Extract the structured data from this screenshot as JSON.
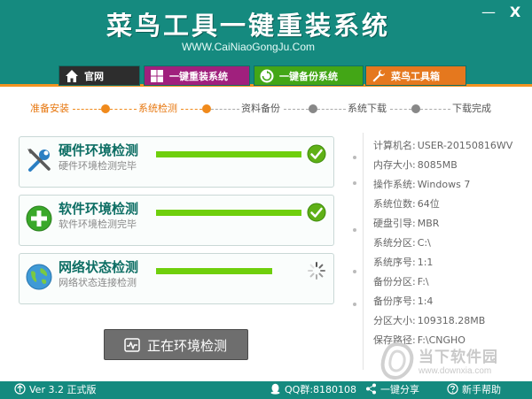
{
  "window": {
    "title": "菜鸟工具一键重装系统",
    "url": "WWW.CaiNiaoGongJu.Com",
    "minimize": "—",
    "close": "X"
  },
  "nav": {
    "tabs": [
      {
        "label": "官网",
        "icon": "home-icon",
        "color": "#2d2d2d"
      },
      {
        "label": "一键重装系统",
        "icon": "windows-icon",
        "color": "#a0207d"
      },
      {
        "label": "一键备份系统",
        "icon": "backup-icon",
        "color": "#43a616"
      },
      {
        "label": "菜鸟工具箱",
        "icon": "wrench-icon",
        "color": "#e5781e"
      }
    ]
  },
  "steps": [
    {
      "label": "准备安装",
      "state": "done"
    },
    {
      "label": "系统检测",
      "state": "active"
    },
    {
      "label": "资料备份",
      "state": "pending"
    },
    {
      "label": "系统下载",
      "state": "pending"
    },
    {
      "label": "下载完成",
      "state": "pending"
    }
  ],
  "checks": [
    {
      "title": "硬件环境检测",
      "subtitle": "硬件环境检测完毕",
      "progress": 1.0,
      "status": "done",
      "icon": "tools-icon"
    },
    {
      "title": "软件环境检测",
      "subtitle": "软件环境检测完毕",
      "progress": 1.0,
      "status": "done",
      "icon": "plus-icon"
    },
    {
      "title": "网络状态检测",
      "subtitle": "网络状态连接检测",
      "progress": 0.8,
      "status": "loading",
      "icon": "globe-icon"
    }
  ],
  "action": {
    "label": "正在环境检测"
  },
  "sysinfo": [
    {
      "key": "计算机名:",
      "value": "USER-20150816WV"
    },
    {
      "key": "内存大小:",
      "value": "8085MB"
    },
    {
      "key": "操作系统:",
      "value": "Windows 7"
    },
    {
      "key": "系统位数:",
      "value": "64位"
    },
    {
      "key": "硬盘引导:",
      "value": "MBR"
    },
    {
      "key": "系统分区:",
      "value": "C:\\"
    },
    {
      "key": "系统序号:",
      "value": "1:1"
    },
    {
      "key": "备份分区:",
      "value": "F:\\"
    },
    {
      "key": "备份序号:",
      "value": "1:4"
    },
    {
      "key": "分区大小:",
      "value": "109318.28MB"
    },
    {
      "key": "保存路径:",
      "value": "F:\\CNGHO"
    }
  ],
  "watermark": {
    "text": "当下软件园",
    "url": "www.downxia.com"
  },
  "footer": {
    "version": "Ver 3.2 正式版",
    "qq": "QQ群:8180108",
    "share": "一键分享",
    "help": "新手帮助"
  },
  "colors": {
    "brand": "#158a7f",
    "accent": "#f39321",
    "progress": "#6fcf0c",
    "title": "#0d6e64"
  }
}
